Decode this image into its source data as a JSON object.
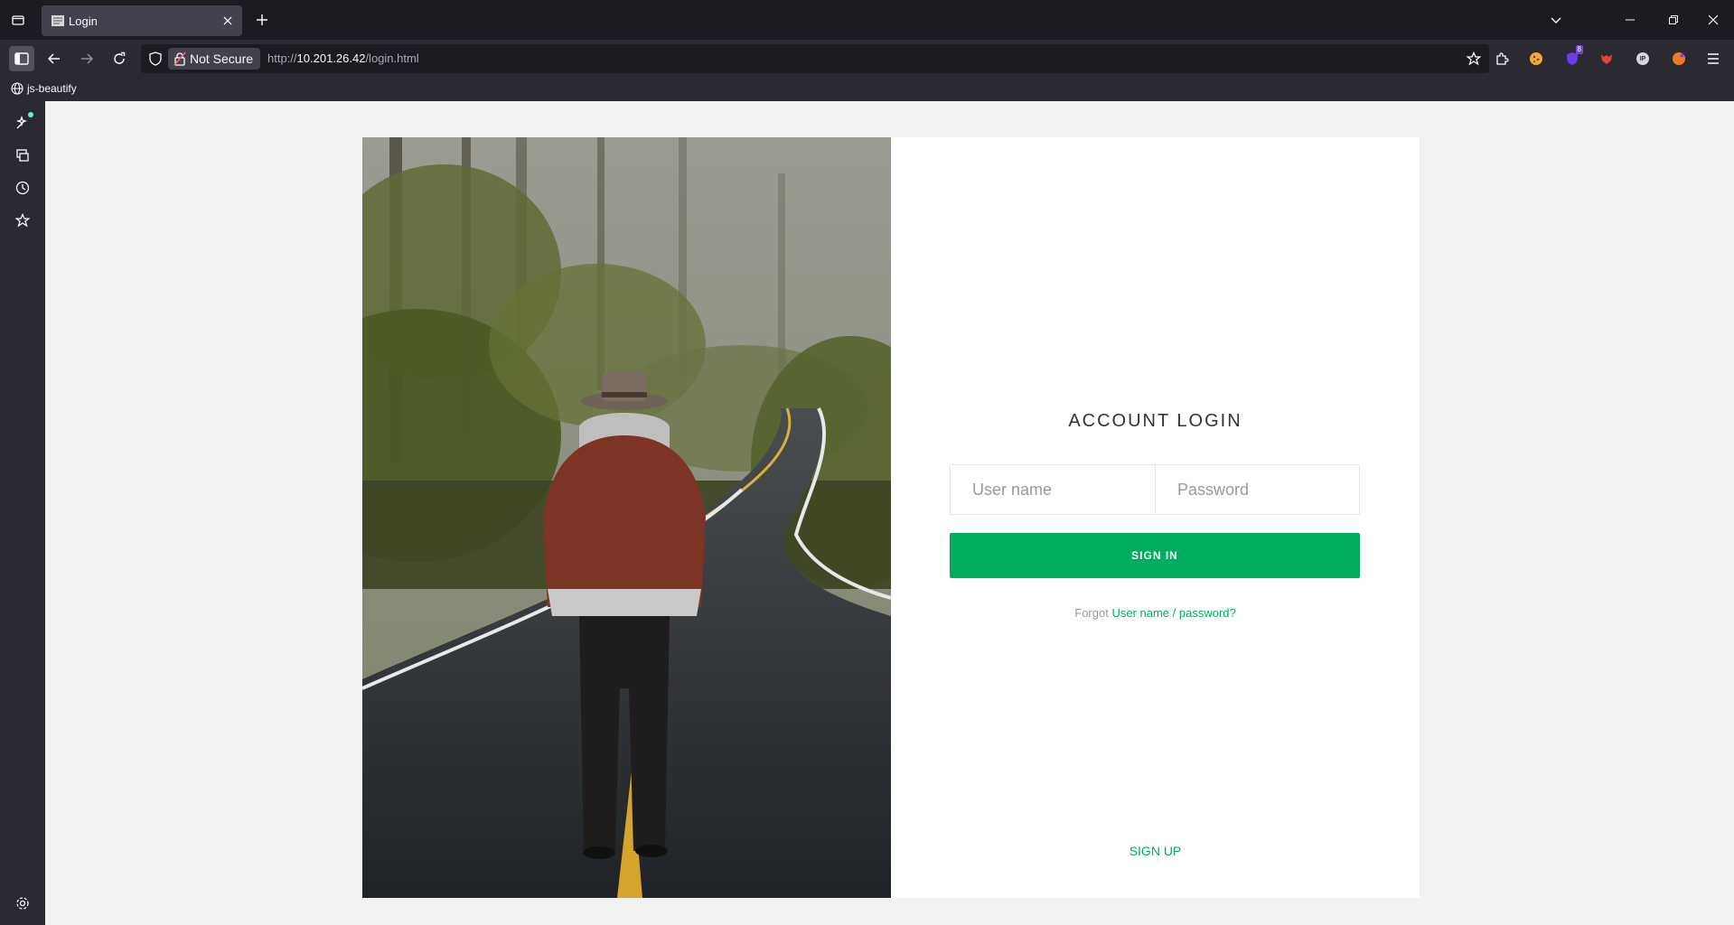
{
  "browser": {
    "tab_title": "Login",
    "url_scheme": "http://",
    "url_host": "10.201.26.42",
    "url_path": "/login.html",
    "security_label": "Not Secure",
    "bookmark_label": "js-beautify",
    "extension_badge": "8",
    "ip_extension_label": "IP"
  },
  "login": {
    "title": "ACCOUNT LOGIN",
    "username_placeholder": "User name",
    "password_placeholder": "Password",
    "signin_label": "SIGN IN",
    "forgot_prefix": "Forgot",
    "forgot_link": "User name / password?",
    "signup_label": "SIGN UP"
  },
  "colors": {
    "accent": "#00ad5f",
    "page_background": "#f2f2f2",
    "browser_chrome": "#2b2a33"
  },
  "icons": {
    "photo": "person-in-hat-and-jacket-walking-on-forest-road"
  }
}
